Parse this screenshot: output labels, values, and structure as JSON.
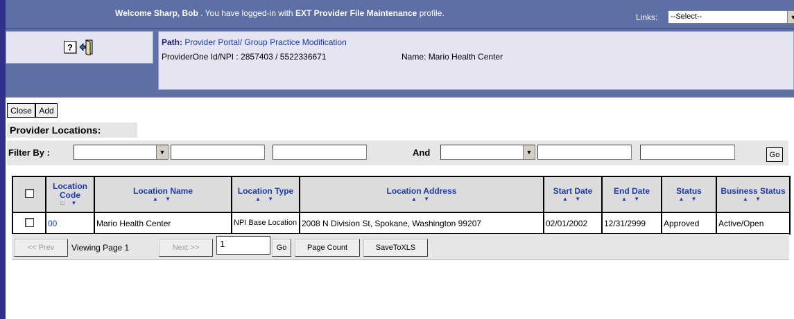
{
  "banner": {
    "welcome_prefix": "Welcome",
    "user_name": "Sharp, Bob",
    "welcome_mid": ". You have logged-in with",
    "profile": "EXT Provider File Maintenance",
    "welcome_suffix": "profile.",
    "links_label": "Links:",
    "links_selected": "--Select--"
  },
  "header": {
    "path_label": "Path:",
    "path_value": "Provider Portal/ Group Practice Modification",
    "provider_id_label": "ProviderOne Id/NPI :",
    "provider_id_value": "2857403 / 5522336671",
    "name_label": "Name:",
    "name_value": "Mario Health Center",
    "help_icon_glyph": "?"
  },
  "toolbar": {
    "close_label": "Close",
    "add_label": "Add"
  },
  "section": {
    "title": "Provider Locations:"
  },
  "filter": {
    "label": "Filter By :",
    "and_label": "And",
    "go_label": "Go"
  },
  "table": {
    "columns": [
      "Location Code",
      "Location Name",
      "Location Type",
      "Location Address",
      "Start Date",
      "End Date",
      "Status",
      "Business Status"
    ],
    "rows": [
      {
        "code": "00",
        "name": "Mario Health Center",
        "type": "NPI Base Location",
        "address": "2008 N Division St, Spokane, Washington 99207",
        "start_date": "02/01/2002",
        "end_date": "12/31/2999",
        "status": "Approved",
        "business_status": "Active/Open"
      }
    ]
  },
  "pager": {
    "prev_label": "<< Prev",
    "viewing_label": "Viewing Page 1",
    "next_label": "Next >>",
    "page_value": "1",
    "go_label": "Go",
    "page_count_label": "Page Count",
    "save_label": "SaveToXLS"
  },
  "colors": {
    "banner": "#5e6fa6",
    "panel": "#e4e4f2",
    "link": "#1a3ca8",
    "grid_header": "#dcdcdc"
  }
}
